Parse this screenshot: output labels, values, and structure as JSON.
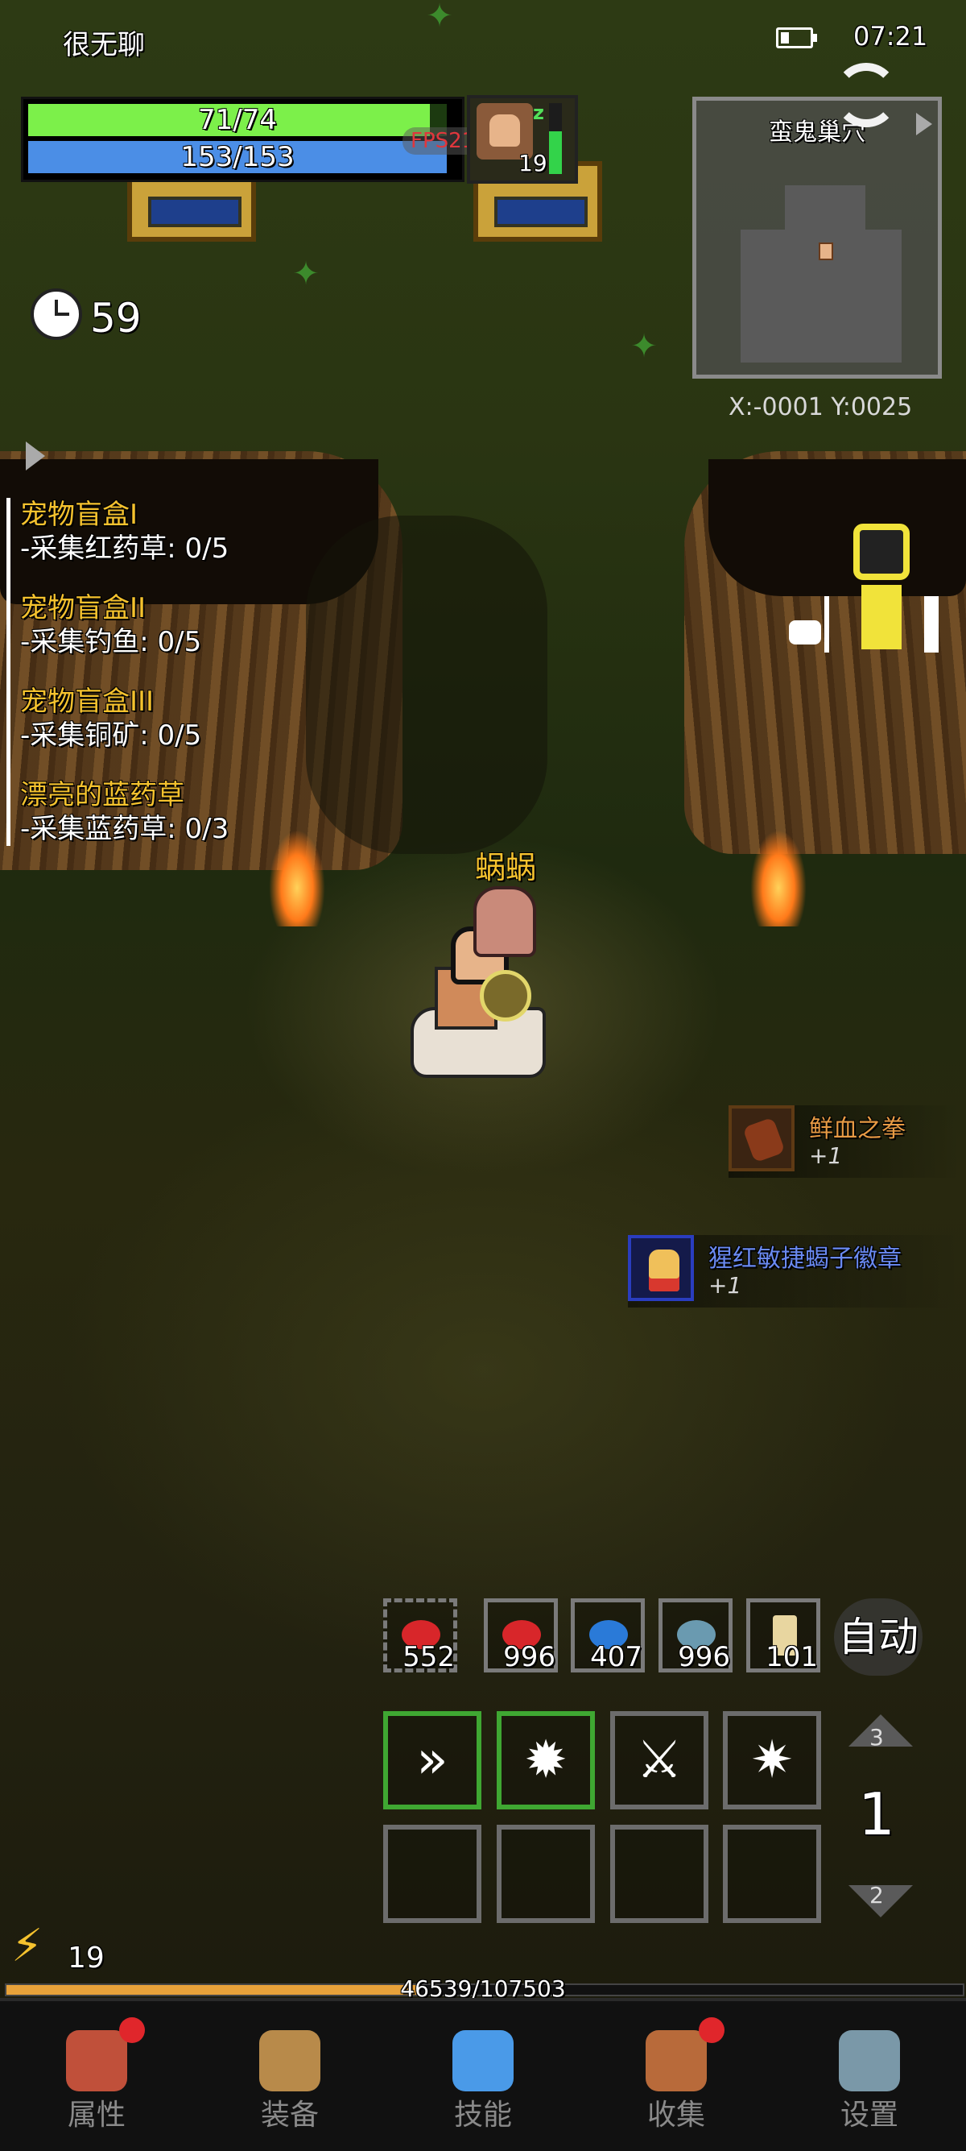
{
  "status_bar": {
    "player_name": "很无聊",
    "time": "07:21"
  },
  "player_stats": {
    "hp": {
      "label": "71/74",
      "fraction": 0.959
    },
    "mp": {
      "label": "153/153",
      "fraction": 1.0
    },
    "fps": "FPS21"
  },
  "pet": {
    "level": "19",
    "energy": 0.6
  },
  "minimap": {
    "map_name": "蛮鬼巢穴",
    "coords": "X:-0001  Y:0025"
  },
  "timer": {
    "value": "59"
  },
  "quests": [
    {
      "title": "宠物盲盒I",
      "task": "-采集红药草: 0/5"
    },
    {
      "title": "宠物盲盒II",
      "task": "-采集钓鱼: 0/5"
    },
    {
      "title": "宠物盲盒III",
      "task": "-采集铜矿: 0/5"
    },
    {
      "title": "漂亮的蓝药草",
      "task": "-采集蓝药草: 0/3"
    }
  ],
  "player": {
    "pet_name": "蜗蜗"
  },
  "loot": [
    {
      "name": "鲜血之拳",
      "count": "+1"
    },
    {
      "name": "猩红敏捷蝎子徽章",
      "count": "+1"
    }
  ],
  "consumables": [
    {
      "count": "552",
      "icon": "red-meat-icon",
      "color": "#d8262a"
    },
    {
      "count": "996",
      "icon": "red-meat-icon",
      "color": "#d8262a"
    },
    {
      "count": "407",
      "icon": "blue-meat-icon",
      "color": "#2a7ad8"
    },
    {
      "count": "996",
      "icon": "fish-icon",
      "color": "#6a9ab0"
    },
    {
      "count": "101",
      "icon": "scroll-icon",
      "color": "#e8d6a0"
    }
  ],
  "auto_button": "自动",
  "skills": [
    {
      "icon": "dash-skill-icon",
      "glyph": "»",
      "active": true
    },
    {
      "icon": "burst-skill-icon",
      "glyph": "✹",
      "active": true
    },
    {
      "icon": "slash-skill-icon",
      "glyph": "⚔",
      "active": false
    },
    {
      "icon": "star-skill-icon",
      "glyph": "✷",
      "active": false
    }
  ],
  "skill_pages": {
    "up": "3",
    "current": "1",
    "down": "2"
  },
  "level": {
    "value": "19"
  },
  "experience": {
    "label": "46539/107503",
    "fraction": 0.433
  },
  "nav": [
    {
      "label": "属性",
      "icon": "helmet-icon",
      "color": "#c0503a",
      "badge": true
    },
    {
      "label": "装备",
      "icon": "bag-icon",
      "color": "#b88a4a",
      "badge": false
    },
    {
      "label": "技能",
      "icon": "crystal-icon",
      "color": "#4a9ae8",
      "badge": false
    },
    {
      "label": "收集",
      "icon": "book-icon",
      "color": "#b86a3a",
      "badge": true
    },
    {
      "label": "设置",
      "icon": "gear-icon",
      "color": "#7a98a8",
      "badge": false
    }
  ]
}
